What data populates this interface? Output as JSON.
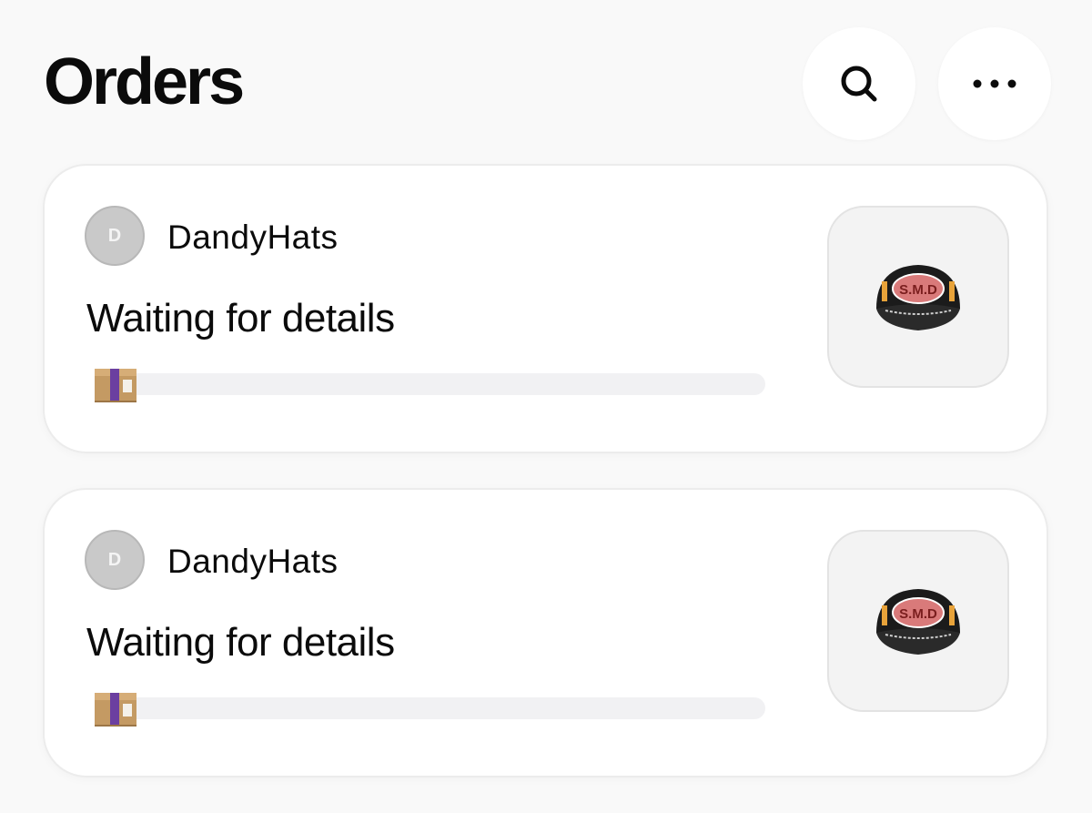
{
  "header": {
    "title": "Orders",
    "search_icon": "search-icon",
    "more_icon": "more-horizontal-icon"
  },
  "orders": [
    {
      "shop_initial": "D",
      "shop_name": "DandyHats",
      "status": "Waiting for details",
      "progress": 0,
      "status_icon": "package-box-icon",
      "product_image": "black-trucker-cap",
      "cap_text": "S.M.D"
    },
    {
      "shop_initial": "D",
      "shop_name": "DandyHats",
      "status": "Waiting for details",
      "progress": 0,
      "status_icon": "package-box-icon",
      "product_image": "black-trucker-cap",
      "cap_text": "S.M.D"
    }
  ],
  "colors": {
    "background": "#f9f9f9",
    "card": "#ffffff",
    "progress_track": "#f1f1f3",
    "avatar": "#c9c9c9",
    "box_brown": "#c49a63",
    "box_tape": "#6b3fa0"
  }
}
